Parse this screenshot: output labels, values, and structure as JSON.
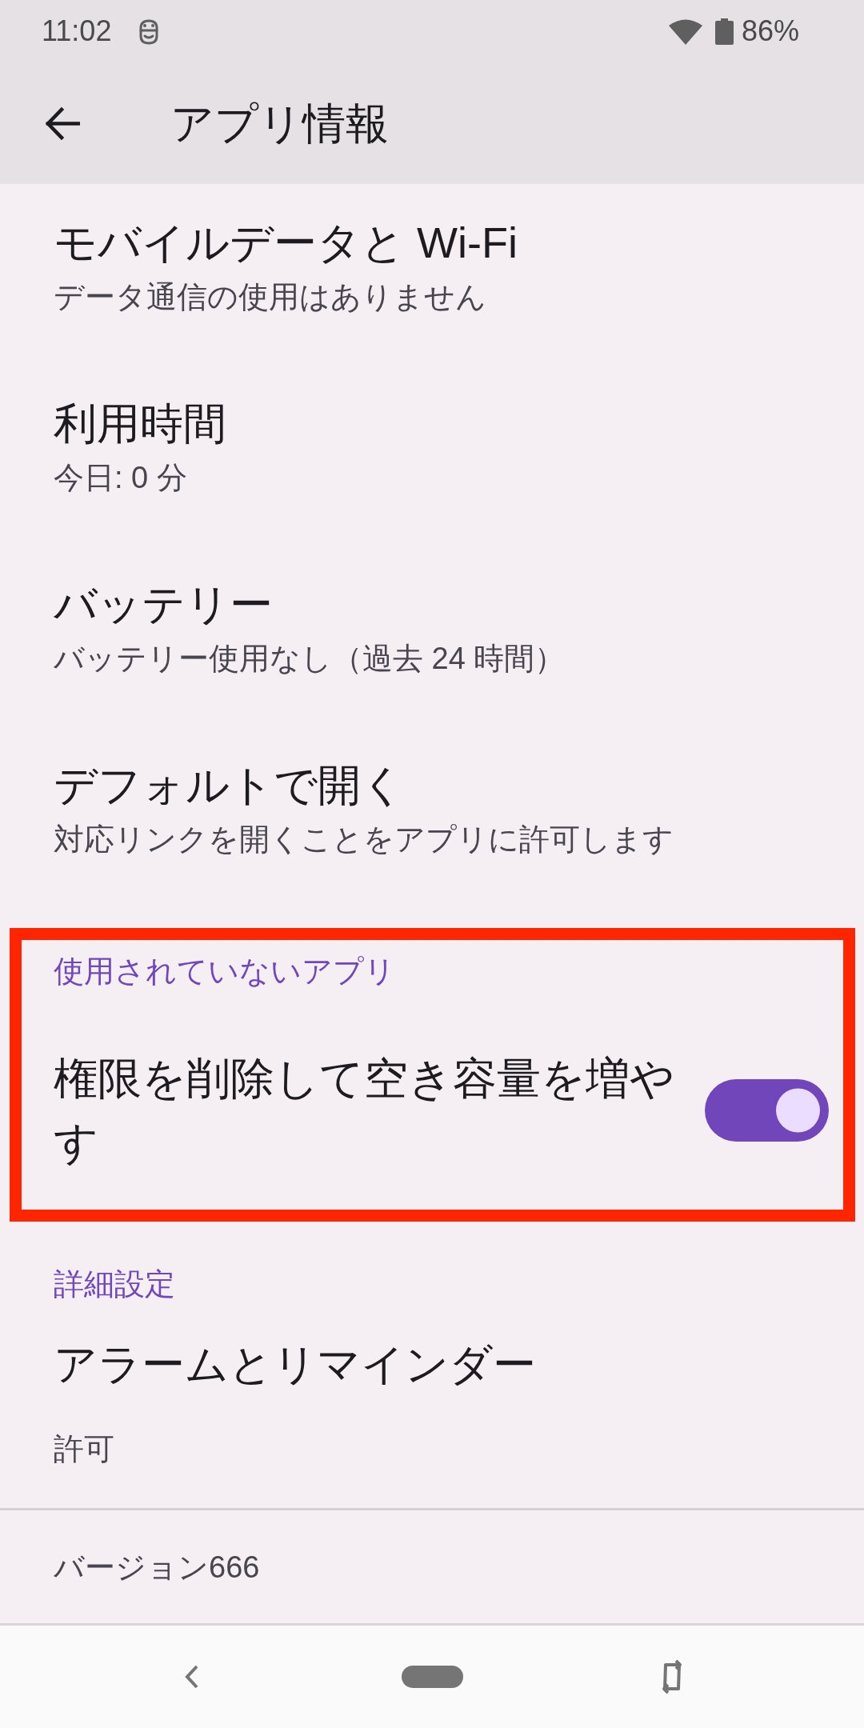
{
  "status_bar": {
    "time": "11:02",
    "battery": "86%"
  },
  "app_bar": {
    "title": "アプリ情報"
  },
  "groups": [
    {
      "items": [
        {
          "kind": "item",
          "title": "モバイルデータと Wi-Fi",
          "summary": "データ通信の使用はありません"
        },
        {
          "kind": "item",
          "title": "利用時間",
          "summary": "今日: 0 分"
        },
        {
          "kind": "item",
          "title": "バッテリー",
          "summary": "バッテリー使用なし（過去 24 時間）"
        },
        {
          "kind": "item",
          "title": "デフォルトで開く",
          "summary": "対応リンクを開くことをアプリに許可します"
        }
      ]
    },
    {
      "header": "使用されていないアプリ",
      "highlighted": true,
      "items": [
        {
          "kind": "switch",
          "title": "権限を削除して空き容量を増やす",
          "on": true
        }
      ]
    },
    {
      "header": "詳細設定",
      "items": [
        {
          "kind": "item",
          "title": "アラームとリマインダー",
          "summary": "許可"
        }
      ]
    }
  ],
  "footer": {
    "version": "バージョン666"
  }
}
